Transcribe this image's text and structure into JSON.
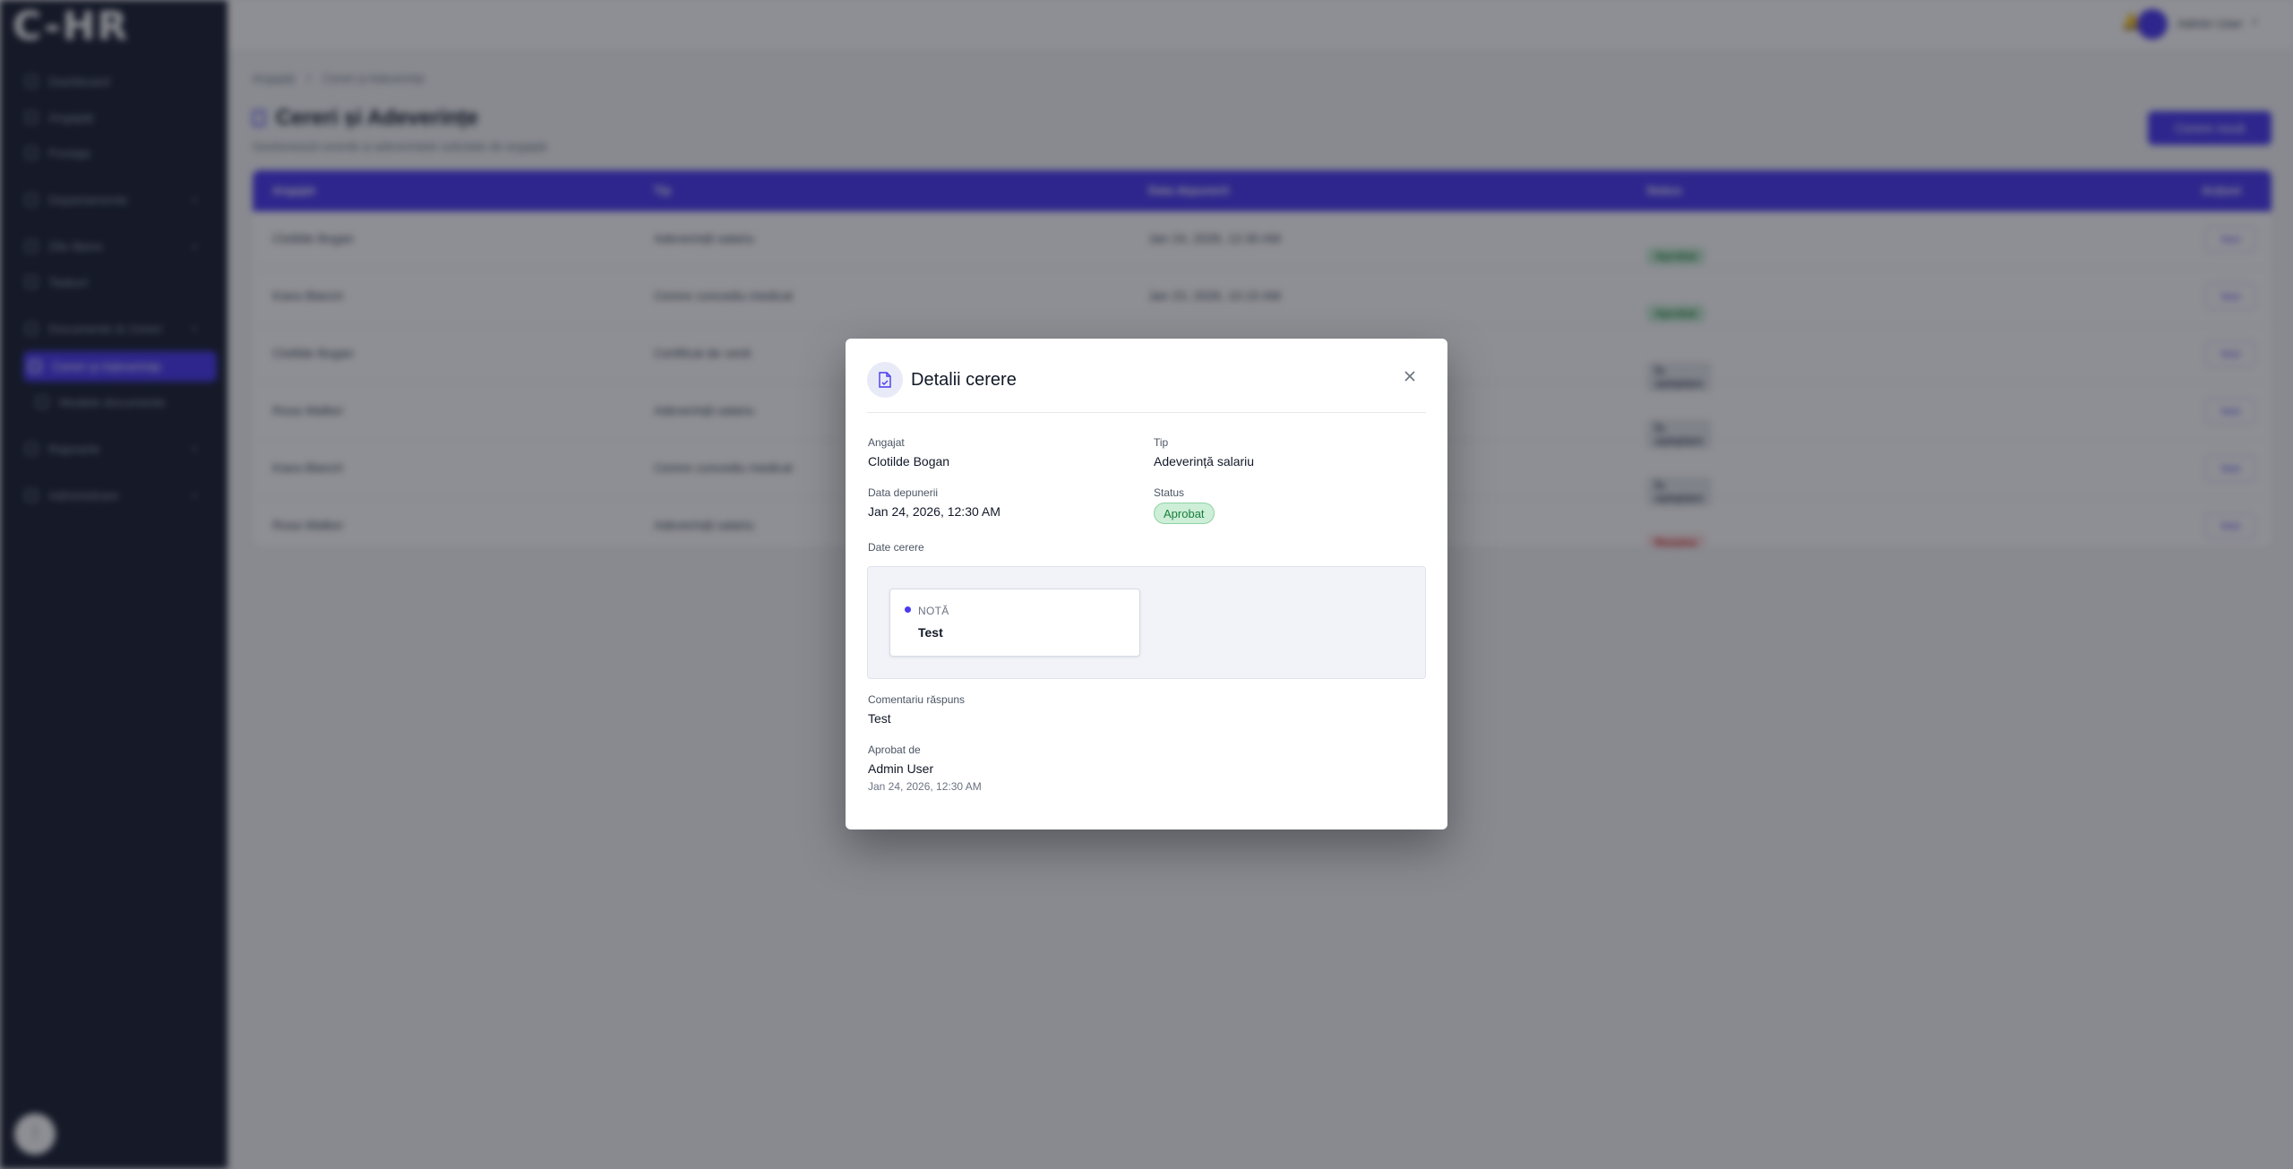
{
  "sidebar": {
    "logo": "C-HR",
    "items": [
      {
        "label": "Dashboard"
      },
      {
        "label": "Angajați"
      },
      {
        "label": "Pontaje"
      },
      {
        "label": "Departamente"
      },
      {
        "label": "Zile libere"
      },
      {
        "label": "Taskuri"
      },
      {
        "label": "Documente & Cereri"
      },
      {
        "label": "Cereri și Adeverințe"
      },
      {
        "label": "Modele documente"
      },
      {
        "label": "Rapoarte"
      },
      {
        "label": "Administrare"
      }
    ]
  },
  "topbar": {
    "user_name": "Admin User"
  },
  "breadcrumb": {
    "parent": "Angajați",
    "current": "Cereri și Adeverințe"
  },
  "page": {
    "title": "Cereri și Adeverințe",
    "subtitle": "Gestionează cererile și adeverințele solicitate de angajați",
    "new_button": "Cerere nouă"
  },
  "table": {
    "headers": [
      "Angajat",
      "Tip",
      "Data depunerii",
      "Status",
      "Acțiuni"
    ],
    "view_label": "Vezi",
    "rows": [
      {
        "employee": "Clotilde Bogan",
        "type": "Adeverință salariu",
        "date": "Jan 24, 2026, 12:30 AM",
        "status": "Aprobat",
        "status_kind": "ok"
      },
      {
        "employee": "Kiara Blanch",
        "type": "Cerere concediu medical",
        "date": "Jan 23, 2026, 10:15 AM",
        "status": "Aprobat",
        "status_kind": "ok"
      },
      {
        "employee": "Clotilde Bogan",
        "type": "Certificat de venit",
        "date": "",
        "status": "În așteptare",
        "status_kind": "wait"
      },
      {
        "employee": "Rosa Walker",
        "type": "Adeverință salariu",
        "date": "",
        "status": "În așteptare",
        "status_kind": "wait"
      },
      {
        "employee": "Kiara Blanch",
        "type": "Cerere concediu medical",
        "date": "",
        "status": "În așteptare",
        "status_kind": "wait"
      },
      {
        "employee": "Rosa Walker",
        "type": "Adeverință salariu",
        "date": "",
        "status": "Respins",
        "status_kind": "no"
      }
    ]
  },
  "modal": {
    "title": "Detalii cerere",
    "employee_label": "Angajat",
    "employee_value": "Clotilde Bogan",
    "type_label": "Tip",
    "type_value": "Adeverință salariu",
    "date_label": "Data depunerii",
    "date_value": "Jan 24, 2026, 12:30 AM",
    "status_label": "Status",
    "status_value": "Aprobat",
    "request_data_label": "Date cerere",
    "note_label": "NOTĂ",
    "note_value": "Test",
    "response_label": "Comentariu răspuns",
    "response_value": "Test",
    "approved_by_label": "Aprobat de",
    "approved_by_value": "Admin User",
    "approved_at": "Jan 24, 2026, 12:30 AM"
  },
  "colors": {
    "accent": "#4a3af0",
    "approved": "#17803d",
    "sidebar": "#1b2133"
  }
}
